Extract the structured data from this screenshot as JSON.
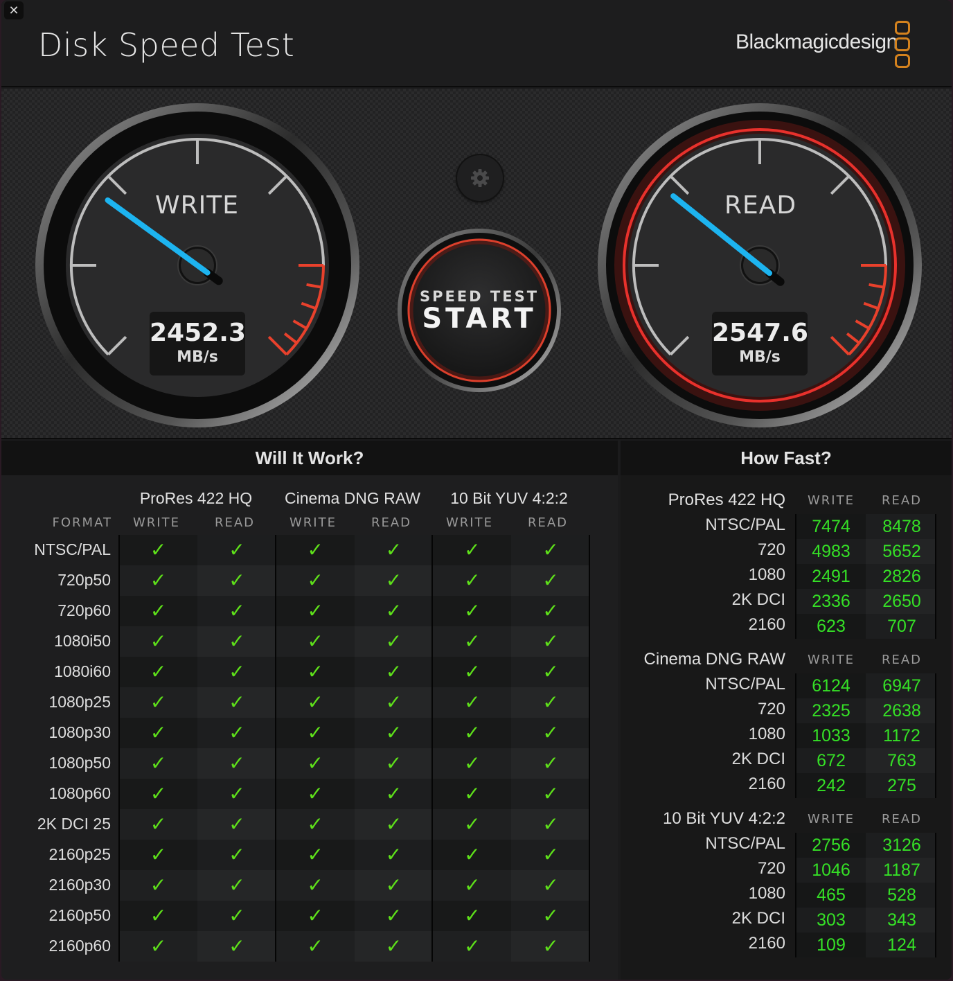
{
  "window": {
    "close_label": "✕",
    "title": "Disk Speed Test",
    "brand": "Blackmagicdesign"
  },
  "gauges": {
    "write": {
      "label": "WRITE",
      "value": "2452.3",
      "unit": "MB/s",
      "needle_fraction": 0.3
    },
    "read": {
      "label": "READ",
      "value": "2547.6",
      "unit": "MB/s",
      "needle_fraction": 0.31
    },
    "colors": {
      "needle": "#1db4f0",
      "redline": "#e8412c",
      "active_ring": "#e8312c"
    }
  },
  "controls": {
    "start_small": "SPEED TEST",
    "start_big": "START",
    "settings_icon": "gear-icon"
  },
  "will_it_work": {
    "title": "Will It Work?",
    "format_header": "FORMAT",
    "codecs": [
      {
        "name": "ProRes 422 HQ",
        "write": "WRITE",
        "read": "READ"
      },
      {
        "name": "Cinema DNG RAW",
        "write": "WRITE",
        "read": "READ"
      },
      {
        "name": "10 Bit YUV 4:2:2",
        "write": "WRITE",
        "read": "READ"
      }
    ],
    "check_glyph": "✓",
    "check_color": "#5ee01a",
    "rows": [
      {
        "format": "NTSC/PAL",
        "results": [
          true,
          true,
          true,
          true,
          true,
          true
        ]
      },
      {
        "format": "720p50",
        "results": [
          true,
          true,
          true,
          true,
          true,
          true
        ]
      },
      {
        "format": "720p60",
        "results": [
          true,
          true,
          true,
          true,
          true,
          true
        ]
      },
      {
        "format": "1080i50",
        "results": [
          true,
          true,
          true,
          true,
          true,
          true
        ]
      },
      {
        "format": "1080i60",
        "results": [
          true,
          true,
          true,
          true,
          true,
          true
        ]
      },
      {
        "format": "1080p25",
        "results": [
          true,
          true,
          true,
          true,
          true,
          true
        ]
      },
      {
        "format": "1080p30",
        "results": [
          true,
          true,
          true,
          true,
          true,
          true
        ]
      },
      {
        "format": "1080p50",
        "results": [
          true,
          true,
          true,
          true,
          true,
          true
        ]
      },
      {
        "format": "1080p60",
        "results": [
          true,
          true,
          true,
          true,
          true,
          true
        ]
      },
      {
        "format": "2K DCI 25",
        "results": [
          true,
          true,
          true,
          true,
          true,
          true
        ]
      },
      {
        "format": "2160p25",
        "results": [
          true,
          true,
          true,
          true,
          true,
          true
        ]
      },
      {
        "format": "2160p30",
        "results": [
          true,
          true,
          true,
          true,
          true,
          true
        ]
      },
      {
        "format": "2160p50",
        "results": [
          true,
          true,
          true,
          true,
          true,
          true
        ]
      },
      {
        "format": "2160p60",
        "results": [
          true,
          true,
          true,
          true,
          true,
          true
        ]
      }
    ]
  },
  "how_fast": {
    "title": "How Fast?",
    "sections": [
      {
        "codec": "ProRes 422 HQ",
        "write_header": "WRITE",
        "read_header": "READ",
        "rows": [
          {
            "format": "NTSC/PAL",
            "write": "7474",
            "read": "8478"
          },
          {
            "format": "720",
            "write": "4983",
            "read": "5652"
          },
          {
            "format": "1080",
            "write": "2491",
            "read": "2826"
          },
          {
            "format": "2K DCI",
            "write": "2336",
            "read": "2650"
          },
          {
            "format": "2160",
            "write": "623",
            "read": "707"
          }
        ]
      },
      {
        "codec": "Cinema DNG RAW",
        "write_header": "WRITE",
        "read_header": "READ",
        "rows": [
          {
            "format": "NTSC/PAL",
            "write": "6124",
            "read": "6947"
          },
          {
            "format": "720",
            "write": "2325",
            "read": "2638"
          },
          {
            "format": "1080",
            "write": "1033",
            "read": "1172"
          },
          {
            "format": "2K DCI",
            "write": "672",
            "read": "763"
          },
          {
            "format": "2160",
            "write": "242",
            "read": "275"
          }
        ]
      },
      {
        "codec": "10 Bit YUV 4:2:2",
        "write_header": "WRITE",
        "read_header": "READ",
        "rows": [
          {
            "format": "NTSC/PAL",
            "write": "2756",
            "read": "3126"
          },
          {
            "format": "720",
            "write": "1046",
            "read": "1187"
          },
          {
            "format": "1080",
            "write": "465",
            "read": "528"
          },
          {
            "format": "2K DCI",
            "write": "303",
            "read": "343"
          },
          {
            "format": "2160",
            "write": "109",
            "read": "124"
          }
        ]
      }
    ]
  }
}
